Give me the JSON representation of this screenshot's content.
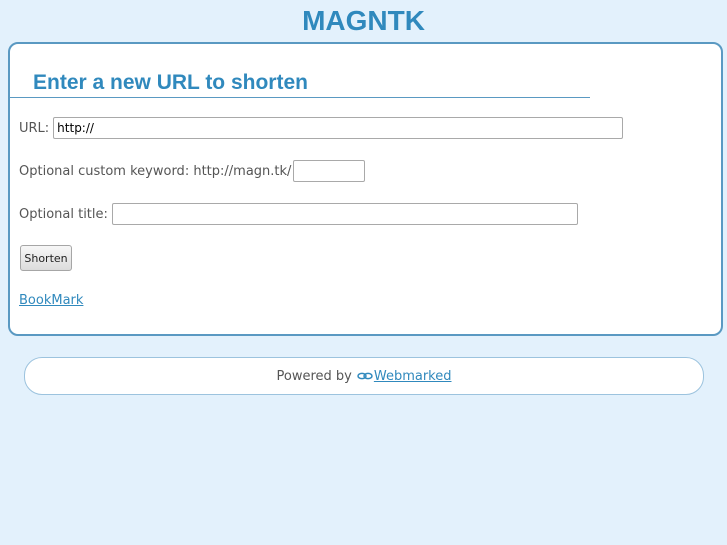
{
  "site": {
    "title": "MAGNTK"
  },
  "form": {
    "heading": "Enter a new URL to shorten",
    "url_label": "URL:",
    "url_value": "http://",
    "keyword_label": "Optional custom keyword: http://magn.tk/",
    "keyword_value": "",
    "title_label": "Optional title:",
    "title_value": "",
    "shorten_label": "Shorten",
    "bookmark_label": "BookMark"
  },
  "footer": {
    "powered_by": "Powered by",
    "link_label": "Webmarked",
    "icon": "link-chain-icon"
  },
  "colors": {
    "background": "#e3f1fc",
    "accent": "#3089bd",
    "panel_border": "#5a99c2"
  }
}
